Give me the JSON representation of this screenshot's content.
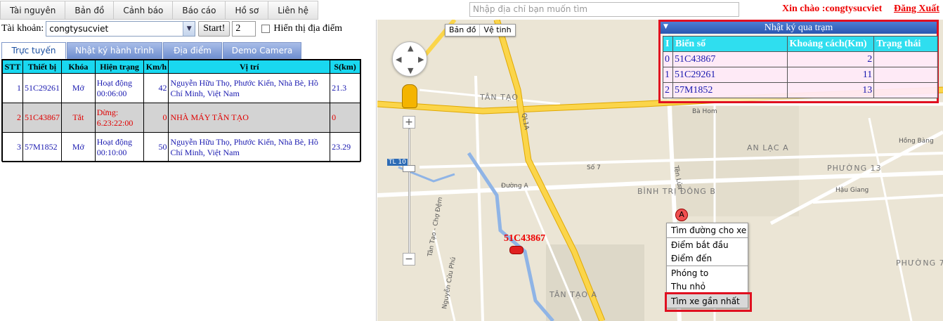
{
  "menu": {
    "items": [
      "Tài nguyên",
      "Bản đồ",
      "Cảnh báo",
      "Báo cáo",
      "Hồ sơ",
      "Liên hệ"
    ]
  },
  "search": {
    "placeholder": "Nhập địa chỉ bạn muốn tìm"
  },
  "user": {
    "greeting": "Xin chào :congtysucviet",
    "logout": "Đăng Xuất"
  },
  "account": {
    "label": "Tài khoản:",
    "selected": "congtysucviet",
    "start_label": "Start!",
    "count": "2",
    "show_places_label": "Hiển thị địa điểm"
  },
  "tabs": [
    "Trực tuyến",
    "Nhật ký hành trình",
    "Địa điểm",
    "Demo Camera"
  ],
  "vehicles": {
    "headers": [
      "STT",
      "Thiết bị",
      "Khóa",
      "Hiện trạng",
      "Km/h",
      "Vị trí",
      "S(km)"
    ],
    "rows": [
      {
        "stt": "1",
        "device": "51C29261",
        "lock": "Mở",
        "status": "Hoạt động 00:06:00",
        "speed": "42",
        "location": "Nguyễn Hữu Thọ, Phước Kiển, Nhà Bè, Hồ Chí Minh, Việt Nam",
        "distance": "21.3"
      },
      {
        "stt": "2",
        "device": "51C43867",
        "lock": "Tắt",
        "status": "Dừng: 6.23:22:00",
        "speed": "0",
        "location": "NHÀ MÁY TÂN TẠO",
        "distance": "0"
      },
      {
        "stt": "3",
        "device": "57M1852",
        "lock": "Mở",
        "status": "Hoạt động 00:10:00",
        "speed": "50",
        "location": "Nguyễn Hữu Thọ, Phước Kiển, Nhà Bè, Hồ Chí Minh, Việt Nam",
        "distance": "23.29"
      }
    ]
  },
  "map": {
    "type_buttons": [
      "Bản đồ",
      "Vệ tinh"
    ],
    "labels": {
      "tan_tao": "TÂN TẠO",
      "tan_tao_a": "TÂN TẠO A",
      "ql1a": "QL1A",
      "binh_tri_dong_b": "BÌNH TRỊ ĐÔNG B",
      "an_lac_a": "AN LẠC A",
      "phuong_13": "PHƯỜNG 13",
      "phuong_7": "PHƯỜNG 7",
      "ba_hom": "Bà Hom",
      "duong_a": "Đường A",
      "so_7": "Số 7",
      "tl10": "TL 10",
      "hau_giang": "Hậu Giang",
      "hong_bang": "Hồng Bàng",
      "ten_lua": "Tên Lửa",
      "tan_tao_cho_dem": "Tân Tạo - Chợ Đệm",
      "nguyen_cuu_phu": "Nguyễn Cửu Phú"
    },
    "car_label": "51C43867",
    "marker_letter": "A"
  },
  "context_menu": {
    "items": [
      "Tìm đường cho xe",
      "Điểm bắt đầu",
      "Điểm đến",
      "Phóng to",
      "Thu nhỏ",
      "Tìm xe gần nhất"
    ]
  },
  "log_panel": {
    "title": "Nhật ký qua trạm",
    "headers": [
      "I",
      "Biển số",
      "Khoảng cách(Km)",
      "Trạng thái"
    ],
    "rows": [
      {
        "i": "0",
        "plate": "51C43867",
        "distance": "2",
        "status": ""
      },
      {
        "i": "1",
        "plate": "51C29261",
        "distance": "11",
        "status": ""
      },
      {
        "i": "2",
        "plate": "57M1852",
        "distance": "13",
        "status": ""
      }
    ]
  }
}
